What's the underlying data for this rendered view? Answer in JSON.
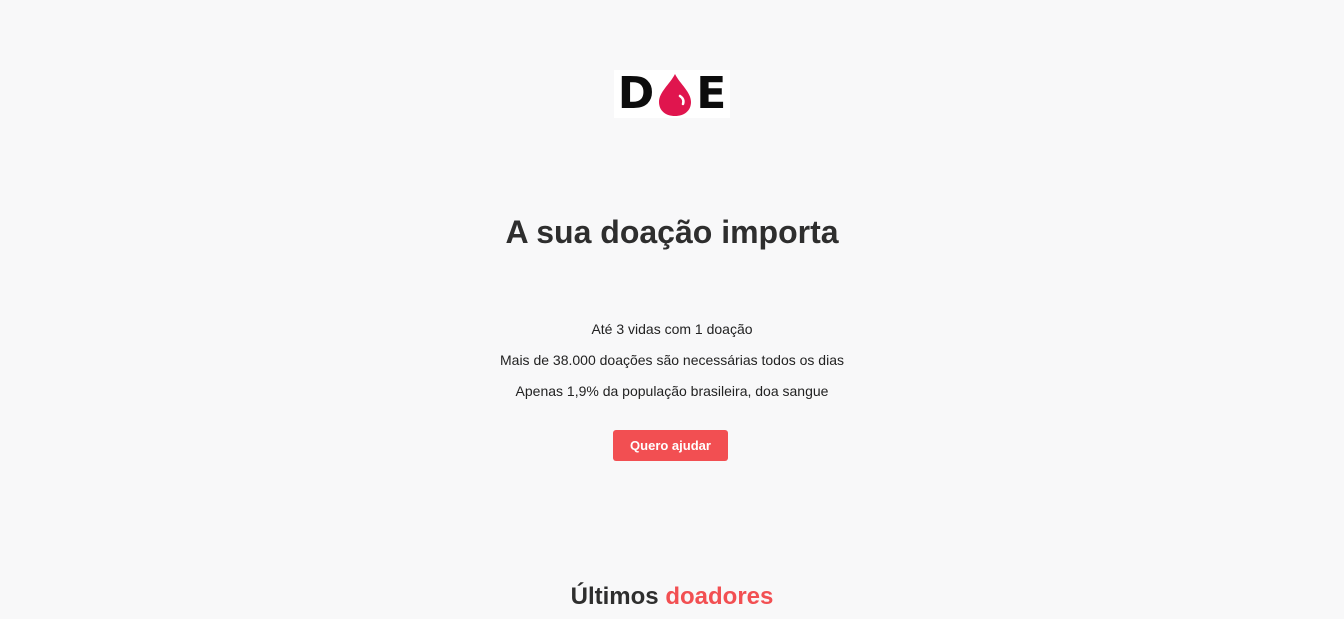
{
  "logo": {
    "text": "DOE",
    "drop_color": "#e0154e",
    "drop_highlight": "#ffffff"
  },
  "hero": {
    "title": "A sua doação importa",
    "facts": [
      "Até 3 vidas com 1 doação",
      "Mais de 38.000 doações são necessárias todos os dias",
      "Apenas 1,9% da população brasileira, doa sangue"
    ],
    "cta_label": "Quero ajudar"
  },
  "donors": {
    "title_part1": "Últimos",
    "title_part2": "doadores"
  },
  "colors": {
    "accent": "#f24f52",
    "text": "#2e2e2e",
    "background": "#f8f8f9"
  }
}
